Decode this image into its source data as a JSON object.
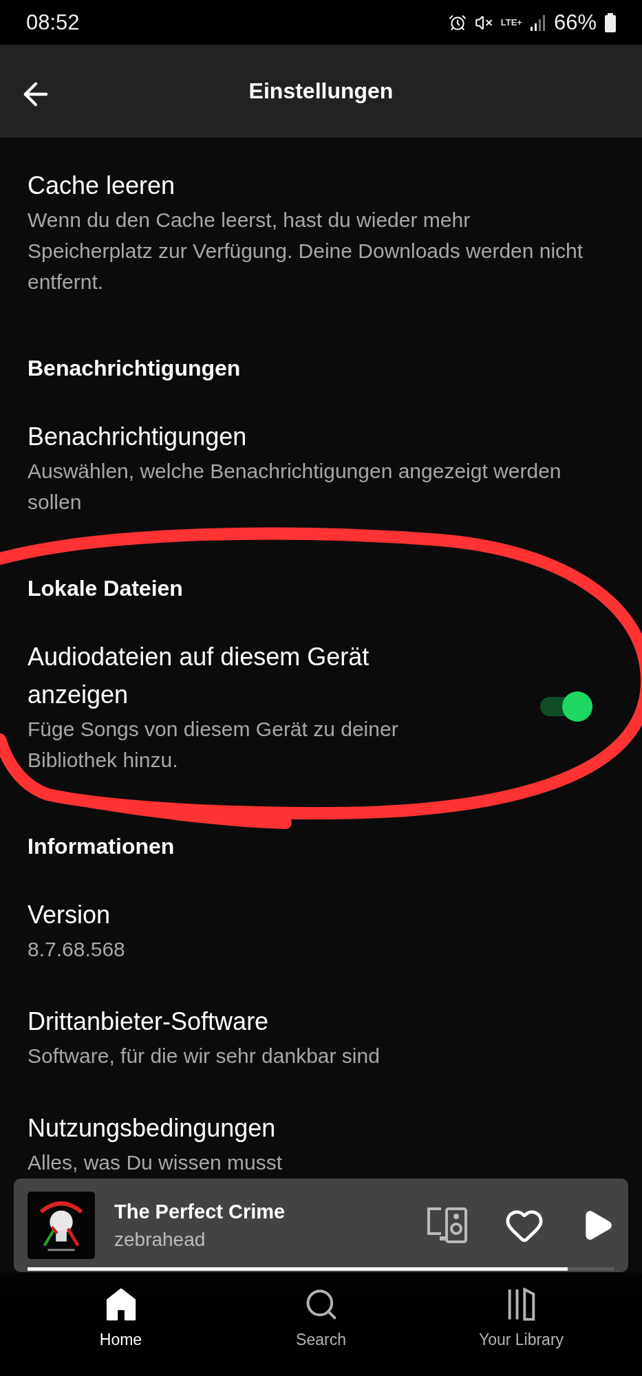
{
  "status_bar": {
    "time": "08:52",
    "network": "LTE+",
    "battery": "66%"
  },
  "header": {
    "title": "Einstellungen"
  },
  "sections": [
    {
      "kind": "item",
      "title": "Cache leeren",
      "subtitle": "Wenn du den Cache leerst, hast du wieder mehr Speicherplatz zur Verfügung. Deine Downloads werden nicht entfernt."
    },
    {
      "kind": "header",
      "title": "Benachrichtigungen"
    },
    {
      "kind": "item",
      "title": "Benachrichtigungen",
      "subtitle": "Auswählen, welche Benachrichtigungen angezeigt werden sollen"
    },
    {
      "kind": "header",
      "title": "Lokale Dateien"
    },
    {
      "kind": "toggle",
      "title": "Audiodateien auf diesem Gerät anzeigen",
      "subtitle": "Füge Songs von diesem Gerät zu deiner Bibliothek hinzu.",
      "on": true
    },
    {
      "kind": "header",
      "title": "Informationen"
    },
    {
      "kind": "item",
      "title": "Version",
      "subtitle": "8.7.68.568"
    },
    {
      "kind": "item",
      "title": "Drittanbieter-Software",
      "subtitle": "Software, für die wir sehr dankbar sind"
    },
    {
      "kind": "item",
      "title": "Nutzungsbedingungen",
      "subtitle": "Alles, was Du wissen musst"
    }
  ],
  "player": {
    "title": "The Perfect Crime",
    "artist": "zebrahead",
    "level": 0.92
  },
  "nav": [
    {
      "kind": "home",
      "label": "Home",
      "selected": true
    },
    {
      "kind": "search",
      "label": "Search",
      "selected": false
    },
    {
      "kind": "library",
      "label": "Your Library",
      "selected": false
    }
  ]
}
